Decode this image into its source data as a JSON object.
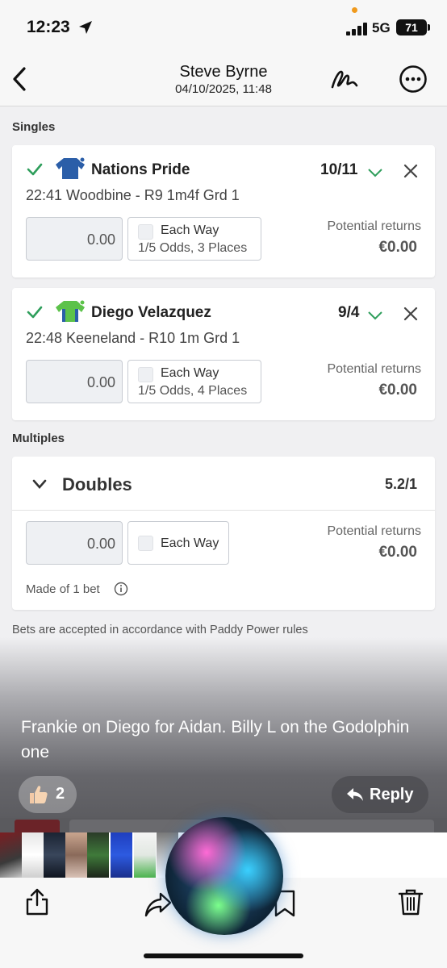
{
  "status_bar": {
    "time": "12:23",
    "network": "5G",
    "battery": "71"
  },
  "nav": {
    "title": "Steve Byrne",
    "subtitle": "04/10/2025, 11:48"
  },
  "singles_label": "Singles",
  "singles": [
    {
      "name": "Nations Pride",
      "odds": "10/11",
      "race": "22:41 Woodbine - R9 1m4f Grd 1",
      "stake": "0.00",
      "each_way": "Each Way",
      "ew_terms": "1/5 Odds, 3 Places",
      "pr_label": "Potential returns",
      "pr_value": "€0.00"
    },
    {
      "name": "Diego Velazquez",
      "odds": "9/4",
      "race": "22:48 Keeneland - R10 1m Grd 1",
      "stake": "0.00",
      "each_way": "Each Way",
      "ew_terms": "1/5 Odds, 4 Places",
      "pr_label": "Potential returns",
      "pr_value": "€0.00"
    }
  ],
  "multiples_label": "Multiples",
  "doubles": {
    "label": "Doubles",
    "odds": "5.2/1",
    "stake": "0.00",
    "each_way": "Each Way",
    "pr_label": "Potential returns",
    "pr_value": "€0.00",
    "made_of": "Made of 1 bet"
  },
  "rules_note": "Bets are accepted in accordance with Paddy Power rules",
  "caption": "Frankie on Diego for Aidan.  Billy L on the Godolphin one",
  "reaction": {
    "emoji": "thumbs-up-icon",
    "count": "2"
  },
  "reply_label": "Reply",
  "icons": [
    "back-chevron-icon",
    "markup-icon",
    "more-icon",
    "share-icon",
    "forward-icon",
    "bookmark-icon",
    "trash-icon"
  ],
  "colors": {
    "accent_green": "#2e9e5b",
    "silk_blue": "#2b5ea8",
    "silk_green": "#5cc24a"
  }
}
